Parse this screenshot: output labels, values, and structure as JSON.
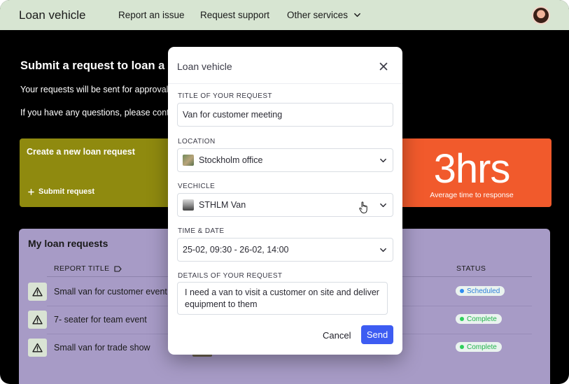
{
  "topnav": {
    "brand": "Loan vehicle",
    "links": [
      "Report an issue",
      "Request support"
    ],
    "other_services": "Other services",
    "chevron_icon": "chevron-down-icon",
    "avatar_icon": "user-avatar"
  },
  "page": {
    "title": "Submit a request to loan a co",
    "line1": "Your requests will be sent for approval a",
    "line2": "If you have any questions, please conta"
  },
  "new_request_card": {
    "title": "Create a new loan request",
    "action": "Submit request",
    "action_icon": "plus-icon",
    "color": "#8f8a0f"
  },
  "stat_card": {
    "value": "3hrs",
    "label": "Average time to response",
    "color": "#f15a2c"
  },
  "requests": {
    "title": "My loan requests",
    "columns": {
      "report_title": "REPORT TITLE",
      "status": "STATUS"
    },
    "rows": [
      {
        "title": "Small van for customer event",
        "status": "Scheduled",
        "status_color": "#2e8cf0",
        "icon": "warning-icon"
      },
      {
        "title": "7- seater for team event",
        "status": "Complete",
        "status_color": "#2fcf5c",
        "icon": "warning-icon"
      },
      {
        "title": "Small van for trade show",
        "status": "Complete",
        "status_color": "#2fcf5c",
        "icon": "warning-icon"
      }
    ],
    "color": "#a79bc6"
  },
  "modal": {
    "title": "Loan vehicle",
    "close_icon": "close-icon",
    "fields": {
      "title_label": "TITLE OF YOUR REQUEST",
      "title_value": "Van for customer meeting",
      "location_label": "LOCATION",
      "location_value": "Stockholm office",
      "vehicle_label": "VECHICLE",
      "vehicle_value": "STHLM Van",
      "time_label": "TIME & DATE",
      "time_value": "25-02, 09:30 - 26-02, 14:00",
      "details_label": "DETAILS OF YOUR REQUEST",
      "details_value": "I need a van to visit a customer on site and deliver equipment to them"
    },
    "cancel_label": "Cancel",
    "send_label": "Send",
    "send_color": "#3d5cf2"
  }
}
